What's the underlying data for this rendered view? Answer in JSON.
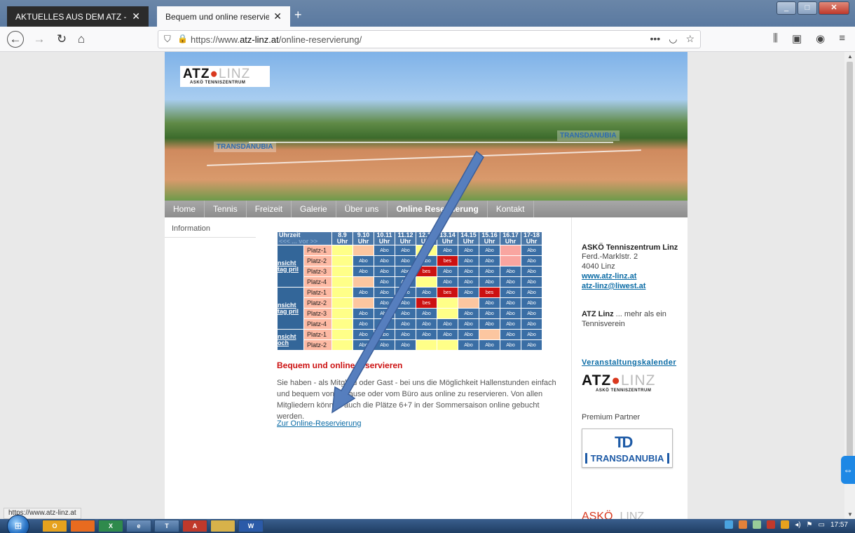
{
  "browser": {
    "tabs": [
      {
        "title": "AKTUELLES AUS DEM ATZ - at",
        "close": "✕"
      },
      {
        "title": "Bequem und online reservieren",
        "close": "✕"
      }
    ],
    "new_tab": "+",
    "url_host": "atz-linz.at",
    "url_prefix": "https://www.",
    "url_path": "/online-reservierung/",
    "status_url": "https://www.atz-linz.at",
    "clock": "17:57"
  },
  "site": {
    "logo": {
      "main": "ATZ",
      "ball": "●",
      "city": "LINZ",
      "sub": "ASKÖ TENNISZENTRUM"
    },
    "banner_sponsors": [
      "TRANSDANUBIA",
      "TRANSDANUBIA"
    ],
    "menu": [
      "Home",
      "Tennis",
      "Freizeit",
      "Galerie",
      "Über uns",
      "Online Reservierung",
      "Kontakt"
    ],
    "left_nav": [
      "Information"
    ],
    "reservation_table": {
      "header_first": "Uhrzeit",
      "header_first_sub": "<<< ... vor >>",
      "slots": [
        "8.9 Uhr",
        "9.10 Uhr",
        "10.11 Uhr",
        "11.12 Uhr",
        "12.13 Uhr",
        "13.14 Uhr",
        "14.15 Uhr",
        "15.16 Uhr",
        "16.17 Uhr",
        "17-18 Uhr"
      ],
      "groups": [
        {
          "day": "nsicht tag pril",
          "rows": [
            {
              "court": "Platz-1",
              "cells": [
                "free",
                "peach",
                "Abo",
                "Abo",
                "free",
                "Abo",
                "Abo",
                "Abo",
                "pink",
                "Abo"
              ]
            },
            {
              "court": "Platz-2",
              "cells": [
                "free",
                "Abo",
                "Abo",
                "Abo",
                "Abo",
                "bes",
                "Abo",
                "Abo",
                "pink",
                "Abo"
              ]
            },
            {
              "court": "Platz-3",
              "cells": [
                "free",
                "Abo",
                "Abo",
                "Abo",
                "bes",
                "Abo",
                "Abo",
                "Abo",
                "Abo",
                "Abo"
              ]
            },
            {
              "court": "Platz-4",
              "cells": [
                "free",
                "peach",
                "Abo",
                "Abo",
                "free",
                "Abo",
                "Abo",
                "Abo",
                "Abo",
                "Abo"
              ]
            }
          ]
        },
        {
          "day": "nsicht tag pril",
          "rows": [
            {
              "court": "Platz-1",
              "cells": [
                "free",
                "Abo",
                "Abo",
                "Abo",
                "Abo",
                "bes",
                "Abo",
                "bes",
                "Abo",
                "Abo"
              ]
            },
            {
              "court": "Platz-2",
              "cells": [
                "free",
                "peach",
                "Abo",
                "Abo",
                "bes",
                "free",
                "peach",
                "Abo",
                "Abo",
                "Abo"
              ]
            },
            {
              "court": "Platz-3",
              "cells": [
                "free",
                "Abo",
                "Abo",
                "Abo",
                "Abo",
                "free",
                "Abo",
                "Abo",
                "Abo",
                "Abo"
              ]
            },
            {
              "court": "Platz-4",
              "cells": [
                "free",
                "Abo",
                "Abo",
                "Abo",
                "Abo",
                "Abo",
                "Abo",
                "Abo",
                "Abo",
                "Abo"
              ]
            }
          ]
        },
        {
          "day": "nsicht och",
          "rows": [
            {
              "court": "Platz-1",
              "cells": [
                "free",
                "Abo",
                "Abo",
                "Abo",
                "Abo",
                "Abo",
                "Abo",
                "peach",
                "Abo",
                "Abo"
              ]
            },
            {
              "court": "Platz-2",
              "cells": [
                "free",
                "Abo",
                "Abo",
                "Abo",
                "free",
                "free",
                "Abo",
                "Abo",
                "Abo",
                "Abo"
              ]
            }
          ]
        }
      ],
      "abo_label": "Abo",
      "bes_label": "bes"
    },
    "content": {
      "title": "Bequem und online reservieren",
      "text": "Sie haben - als Mitglied oder Gast - bei uns die Möglichkeit Hallenstunden einfach und bequem von zuhause oder vom Büro aus online zu reservieren. Von allen Mitgliedern können auch die Plätze 6+7 in der Sommersaison online gebucht werden.",
      "link": "Zur Online-Reservierung"
    },
    "sidebar": {
      "title": "ASKÖ Tenniszentrum Linz",
      "street": "Ferd.-Marklstr. 2",
      "city": "4040 Linz",
      "web": "www.atz-linz.at",
      "email": "atz-linz@liwest.at",
      "tagline_bold": "ATZ Linz",
      "tagline": " ... mehr als ein Tennisverein",
      "calendar": "Veranstaltungskalender",
      "premium": "Premium Partner",
      "partner_mark": "TD",
      "partner_name": "TRANSDANUBIA",
      "bottom_logo": "ASKÖ",
      "bottom_logo_city": "LINZ"
    }
  },
  "taskbar": {
    "apps": [
      "O",
      "",
      "X",
      "e",
      "T",
      "A",
      "",
      "W"
    ]
  },
  "colors": {
    "abo": "#3a6ea5",
    "bes": "#cc1111",
    "free": "#ffff88",
    "accent": "#cc1111",
    "link": "#0a6ba5"
  }
}
